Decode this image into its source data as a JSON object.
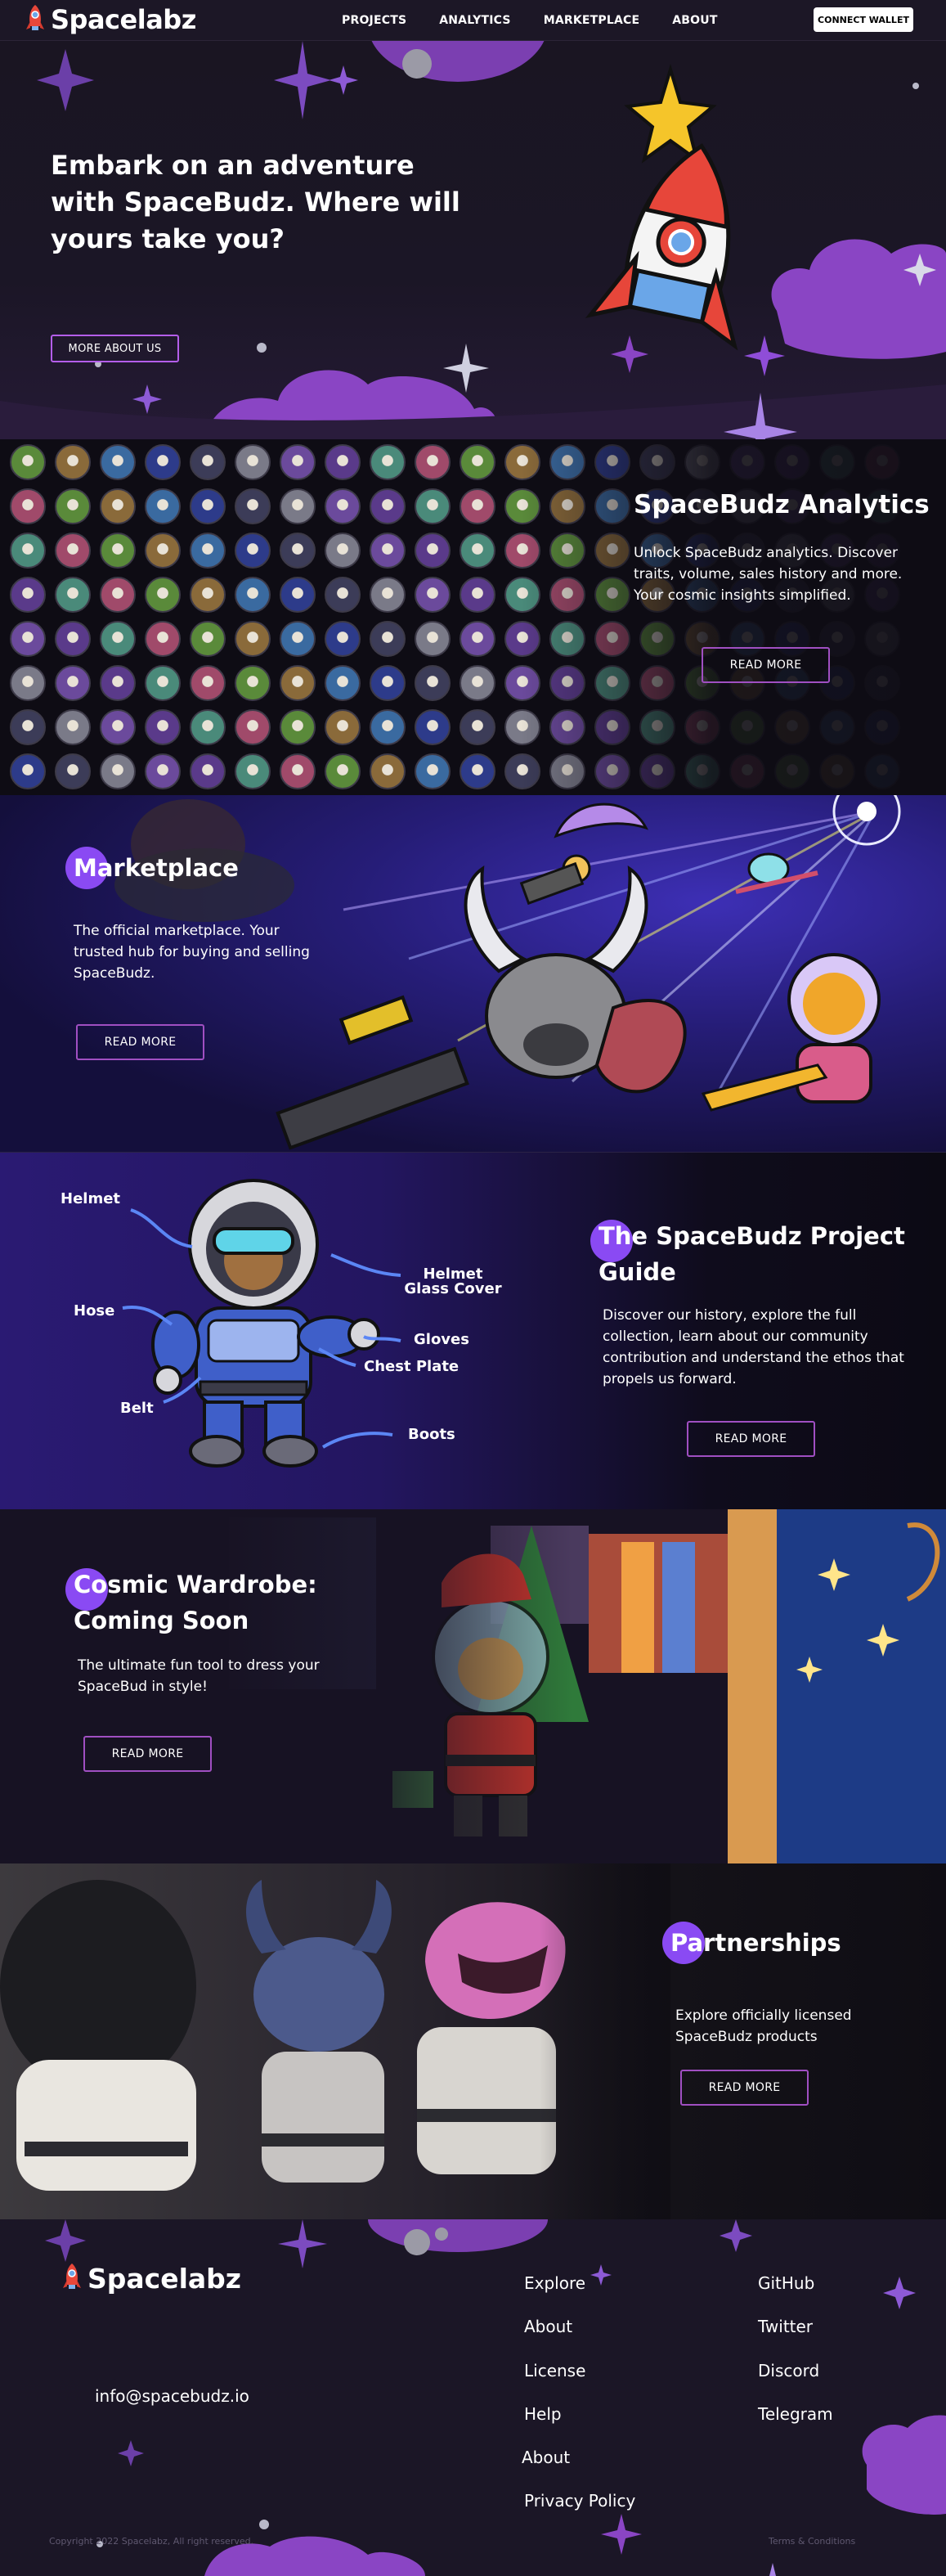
{
  "header": {
    "brand": "Spacelabz",
    "nav": [
      "PROJECTS",
      "ANALYTICS",
      "MARKETPLACE",
      "ABOUT"
    ],
    "connect_label": "CONNECT WALLET"
  },
  "hero": {
    "title": "Embark on an adventure with SpaceBudz. Where will yours take you?",
    "button": "MORE ABOUT US"
  },
  "analytics": {
    "title": "SpaceBudz Analytics",
    "body": "Unlock SpaceBudz analytics. Discover traits, volume, sales history and more. Your cosmic insights simplified.",
    "button": "READ MORE"
  },
  "marketplace": {
    "title": "Marketplace",
    "body": "The official marketplace. Your trusted hub for buying and selling SpaceBudz.",
    "button": "READ MORE"
  },
  "guide": {
    "title": "The SpaceBudz Project Guide",
    "body": "Discover our history, explore the full collection, learn about our community contribution and understand the ethos that propels us forward.",
    "button": "READ MORE",
    "labels": {
      "helmet": "Helmet",
      "hose": "Hose",
      "belt": "Belt",
      "helmet_glass_cover": "Helmet Glass Cover",
      "gloves": "Gloves",
      "chest_plate": "Chest Plate",
      "boots": "Boots"
    }
  },
  "wardrobe": {
    "title": "Cosmic Wardrobe: Coming Soon",
    "body": "The ultimate fun tool to dress your SpaceBud in style!",
    "button": "READ MORE"
  },
  "partnerships": {
    "title": "Partnerships",
    "body": "Explore officially licensed SpaceBudz products",
    "button": "READ MORE"
  },
  "footer": {
    "brand": "Spacelabz",
    "email": "info@spacebudz.io",
    "col1": [
      "Explore",
      "About",
      "License",
      "Help",
      "About",
      "Privacy Policy"
    ],
    "col2": [
      "GitHub",
      "Twitter",
      "Discord",
      "Telegram"
    ],
    "copyright": "Copyright 2022 Spacelabz, All right reserved.",
    "terms": "Terms & Conditions"
  },
  "colors": {
    "accent_purple": "#8a4af3",
    "button_border": "#a04fc2",
    "background": "#17131f"
  }
}
